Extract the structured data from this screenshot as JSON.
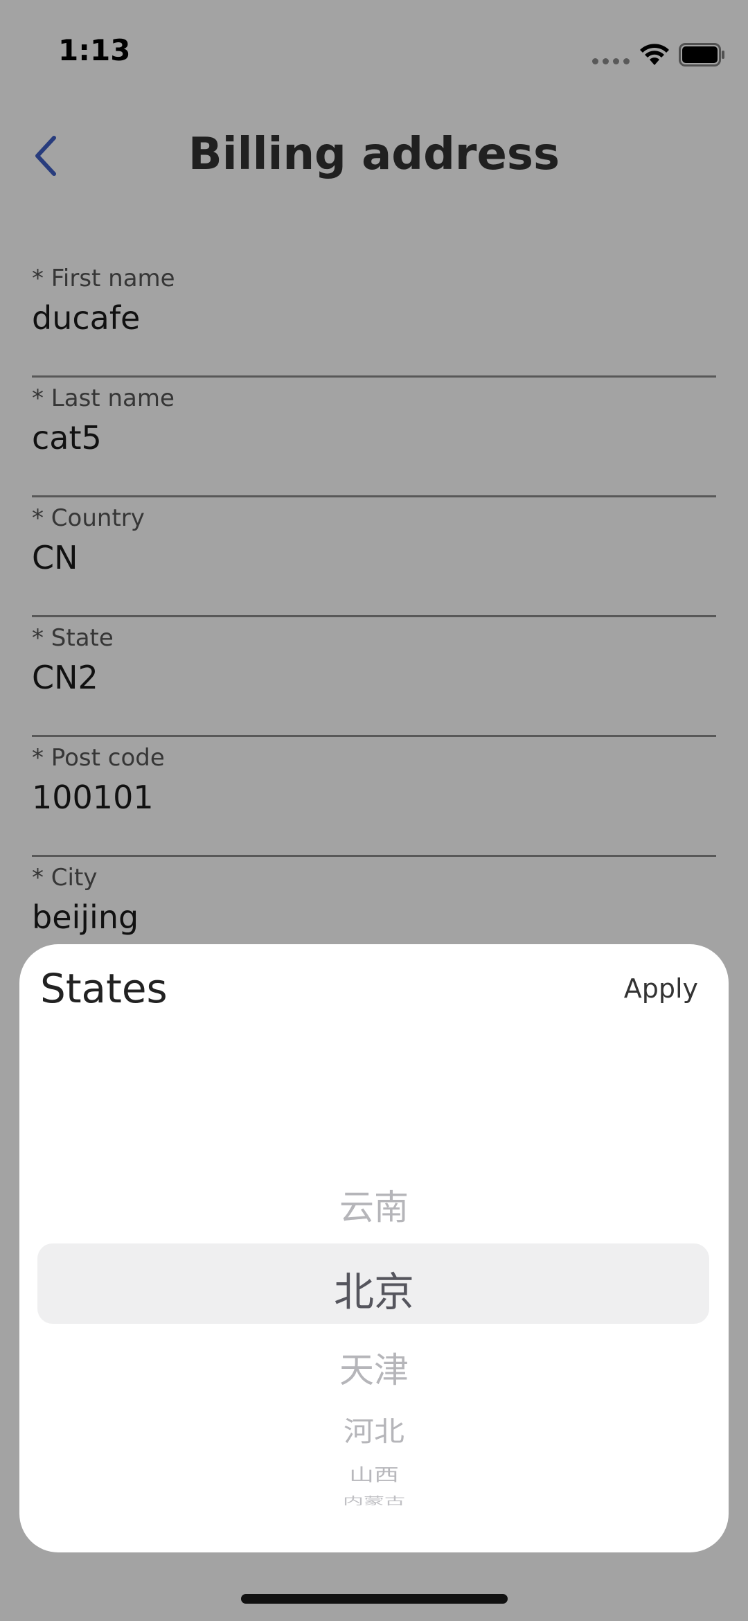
{
  "status_bar": {
    "time": "1:13"
  },
  "header": {
    "title": "Billing address"
  },
  "form": {
    "fields": [
      {
        "label": "* First name",
        "value": "ducafe"
      },
      {
        "label": "* Last name",
        "value": "cat5"
      },
      {
        "label": "* Country",
        "value": "CN"
      },
      {
        "label": "* State",
        "value": "CN2"
      },
      {
        "label": "* Post code",
        "value": "100101"
      },
      {
        "label": "* City",
        "value": "beijing"
      }
    ]
  },
  "sheet": {
    "title": "States",
    "apply_label": "Apply",
    "options": [
      "云南",
      "北京",
      "天津",
      "河北",
      "山西",
      "内蒙古"
    ],
    "selected": "北京"
  },
  "colors": {
    "accent": "#3f5fc4",
    "overlay": "#000000"
  },
  "icons": {
    "back": "chevron-left-icon",
    "wifi": "wifi-icon",
    "battery": "battery-icon",
    "signal": "cellular-signal-icon"
  }
}
